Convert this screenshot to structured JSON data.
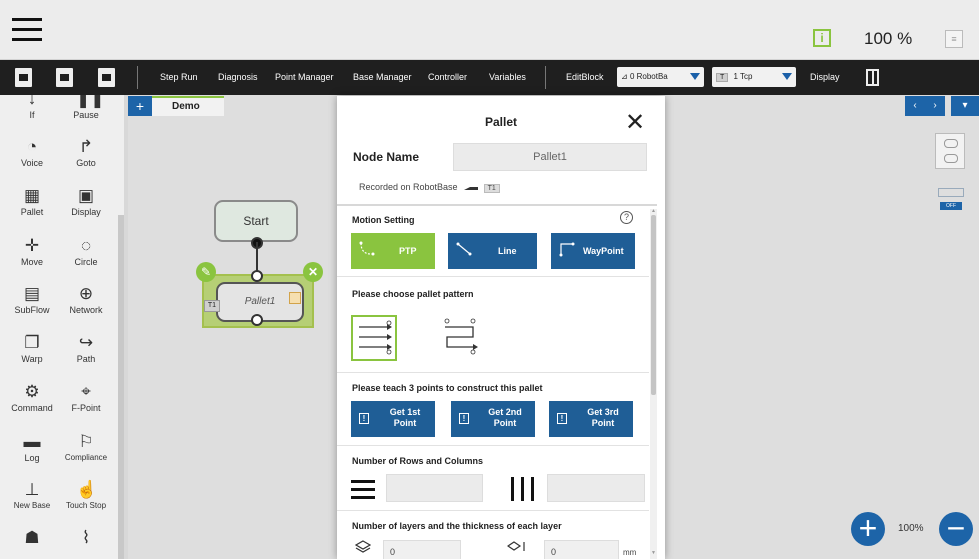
{
  "topbar": {
    "zoom_percent": "100 %",
    "info_label": "i"
  },
  "toolbar": {
    "items": [
      "Step Run",
      "Diagnosis",
      "Point Manager",
      "Base Manager",
      "Controller",
      "Variables",
      "EditBlock",
      "Display"
    ],
    "base_dropdown": "0 RobotBa",
    "tcp_chip": "T",
    "tcp_dropdown": "1 Tcp"
  },
  "palette": {
    "items": [
      {
        "label": "If",
        "icon": "if-icon"
      },
      {
        "label": "Pause",
        "icon": "pause-icon"
      },
      {
        "label": "Voice",
        "icon": "voice-icon"
      },
      {
        "label": "Goto",
        "icon": "goto-icon"
      },
      {
        "label": "Pallet",
        "icon": "pallet-icon"
      },
      {
        "label": "Display",
        "icon": "display-icon"
      },
      {
        "label": "Move",
        "icon": "move-icon"
      },
      {
        "label": "Circle",
        "icon": "circle-icon"
      },
      {
        "label": "SubFlow",
        "icon": "subflow-icon"
      },
      {
        "label": "Network",
        "icon": "network-icon"
      },
      {
        "label": "Warp",
        "icon": "warp-icon"
      },
      {
        "label": "Path",
        "icon": "path-icon"
      },
      {
        "label": "Command",
        "icon": "command-icon"
      },
      {
        "label": "F-Point",
        "icon": "fpoint-icon"
      },
      {
        "label": "Log",
        "icon": "log-icon"
      },
      {
        "label": "Compliance",
        "icon": "compliance-icon"
      },
      {
        "label": "New Base",
        "icon": "new-base-icon"
      },
      {
        "label": "Touch Stop",
        "icon": "touch-stop-icon"
      }
    ]
  },
  "canvas": {
    "tab_add": "+",
    "tab_name": "Demo",
    "start_node": "Start",
    "pallet_node": "Pallet1",
    "node_tag": "T1",
    "zoom": "100%"
  },
  "dialog": {
    "title": "Pallet",
    "node_name_label": "Node Name",
    "node_name_value": "Pallet1",
    "recorded_on": "Recorded on RobotBase",
    "recorded_tag": "T1",
    "motion_setting": "Motion Setting",
    "help": "?",
    "motion_buttons": [
      {
        "label": "PTP",
        "color": "#8ac43f"
      },
      {
        "label": "Line",
        "color": "#1f5e96"
      },
      {
        "label": "WayPoint",
        "color": "#1f5e96"
      }
    ],
    "pattern_title": "Please choose pallet pattern",
    "teach_title": "Please teach 3 points to construct this pallet",
    "teach_buttons": [
      {
        "line1": "Get 1st",
        "line2": "Point"
      },
      {
        "line1": "Get 2nd",
        "line2": "Point"
      },
      {
        "line1": "Get 3rd",
        "line2": "Point"
      }
    ],
    "rows_title": "Number of Rows and Columns",
    "layers_title": "Number of layers and the thickness of each layer",
    "layer_count": "0",
    "thickness": "0",
    "thickness_unit": "mm"
  },
  "colors": {
    "accent_green": "#8ac43f",
    "brand_blue": "#1d64a8",
    "toolbar_bg": "#1f1f1f"
  }
}
